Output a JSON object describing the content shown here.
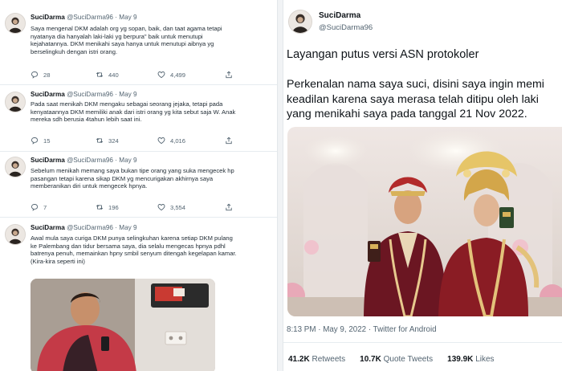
{
  "thread": [
    {
      "name": "SuciDarma",
      "handle": "@SuciDarma96 · May 9",
      "lines": [
        "Saya mengenal DKM adalah org yg sopan, baik, dan taat agama tetapi",
        "nyatanya dia hanyalah laki-laki yg berpura\" baik untuk menutupi",
        "kejahatannya. DKM menikahi saya hanya untuk menutupi aibnya yg",
        "berselingkuh dengan istri orang."
      ],
      "replies": "28",
      "retweets": "440",
      "likes": "4,499"
    },
    {
      "name": "SuciDarma",
      "handle": "@SuciDarma96 · May 9",
      "lines": [
        "Pada saat menikah DKM mengaku sebagai seorang jejaka, tetapi pada",
        "kenyataannya DKM memiliki anak dari istri orang yg kita sebut saja W. Anak",
        "mereka sdh berusia 4tahun lebih saat ini."
      ],
      "replies": "15",
      "retweets": "324",
      "likes": "4,016"
    },
    {
      "name": "SuciDarma",
      "handle": "@SuciDarma96 · May 9",
      "lines": [
        "Sebelum menikah memang saya bukan tipe orang yang suka mengecek hp",
        "pasangan tetapi karena sikap DKM yg mencurigakan akhirnya saya",
        "memberanikan diri untuk mengecek hpnya."
      ],
      "replies": "7",
      "retweets": "196",
      "likes": "3,554"
    },
    {
      "name": "SuciDarma",
      "handle": "@SuciDarma96 · May 9",
      "lines": [
        "Awal mula saya curiga DKM punya selingkuhan karena setiap DKM pulang",
        "ke Palembang dan tidur bersama saya, dia selalu mengecas hpnya pdhl",
        "batrenya penuh, memainkan hpny smbil senyum ditengah kegelapan kamar.",
        "(Kira-kira seperti ini)"
      ]
    }
  ],
  "main": {
    "name": "SuciDarma",
    "handle": "@SuciDarma96",
    "line1": "Layangan putus versi ASN protokoler",
    "para": [
      "Perkenalan nama saya suci, disini saya ingin memi",
      "keadilan karena saya merasa telah ditipu oleh laki",
      "yang menikahi saya pada tanggal 21 Nov 2022."
    ],
    "meta": "8:13 PM · May 9, 2022 · Twitter for Android",
    "retweets_count": "41.2K",
    "retweets_label": "Retweets",
    "quotes_count": "10.7K",
    "quotes_label": "Quote Tweets",
    "likes_count": "139.9K",
    "likes_label": "Likes"
  }
}
